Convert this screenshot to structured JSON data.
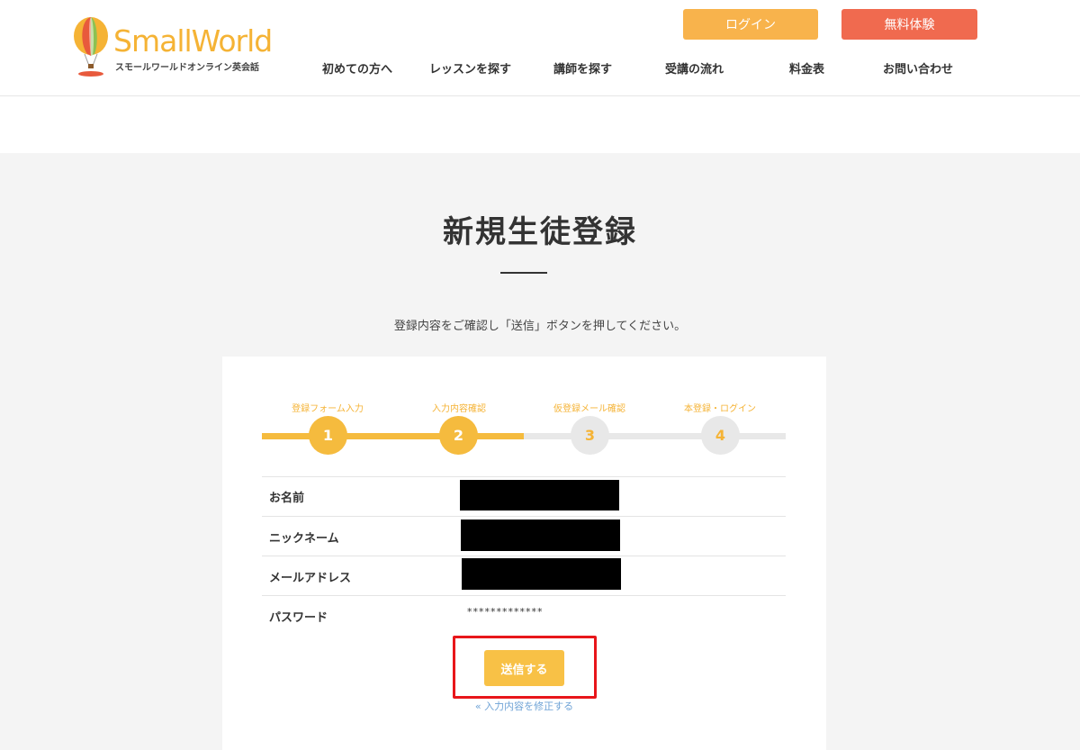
{
  "header": {
    "logo": {
      "name": "SmallWorld",
      "subtitle": "スモールワールドオンライン英会話",
      "icon": "hot-air-balloon-icon"
    },
    "buttons": {
      "login": "ログイン",
      "trial": "無料体験"
    },
    "nav": [
      "初めての方へ",
      "レッスンを探す",
      "講師を探す",
      "受講の流れ",
      "料金表",
      "お問い合わせ"
    ]
  },
  "main": {
    "title": "新規生徒登録",
    "instruction": "登録内容をご確認し「送信」ボタンを押してください。",
    "steps": [
      {
        "label": "登録フォーム入力",
        "number": "1",
        "state": "done"
      },
      {
        "label": "入力内容確認",
        "number": "2",
        "state": "current"
      },
      {
        "label": "仮登録メール確認",
        "number": "3",
        "state": "pending"
      },
      {
        "label": "本登録・ログイン",
        "number": "4",
        "state": "pending"
      }
    ],
    "fields": [
      {
        "label": "お名前",
        "value_redacted": true
      },
      {
        "label": "ニックネーム",
        "value_redacted": true
      },
      {
        "label": "メールアドレス",
        "value_redacted": true
      },
      {
        "label": "パスワード",
        "value": "*************"
      }
    ],
    "submit_label": "送信する",
    "back_link": "« 入力内容を修正する"
  },
  "colors": {
    "accent": "#f5bb3e",
    "login_button": "#f8b34c",
    "trial_button": "#f06a4f",
    "highlight": "#e8161a",
    "link": "#6fa3d6"
  }
}
